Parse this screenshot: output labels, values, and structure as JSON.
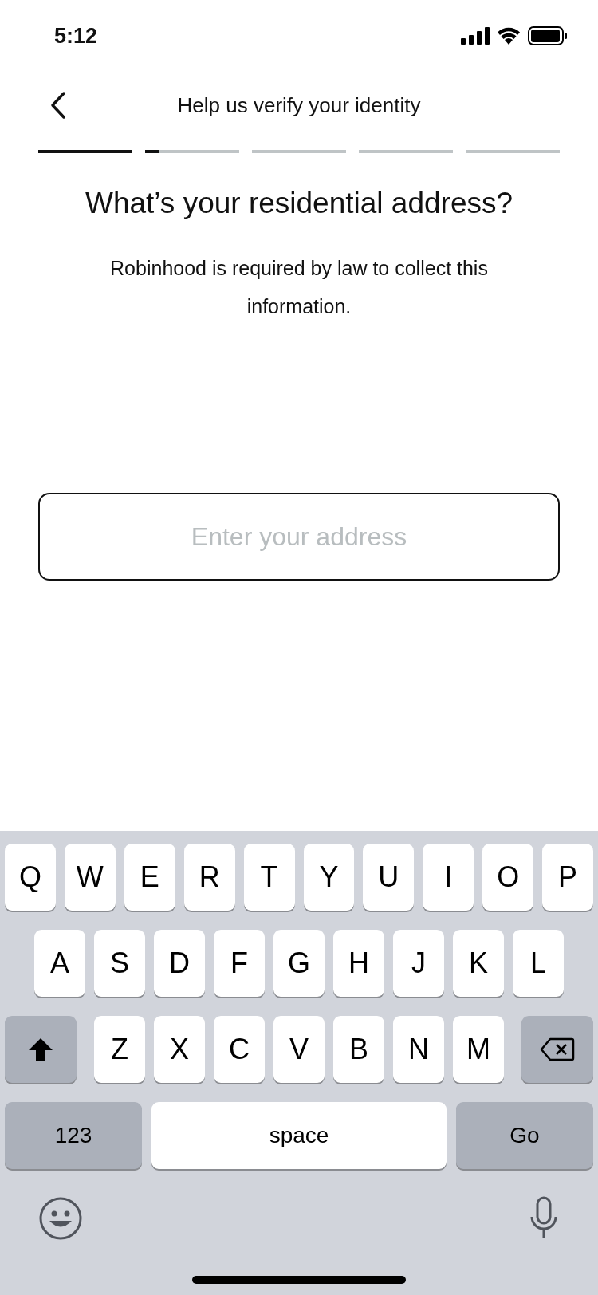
{
  "status_bar": {
    "time": "5:12"
  },
  "header": {
    "title": "Help us verify your identity"
  },
  "progress": [
    {
      "kind": "started",
      "level": 1
    },
    {
      "kind": "started",
      "level": 0.15
    },
    {
      "kind": "upcoming"
    },
    {
      "kind": "upcoming"
    },
    {
      "kind": "upcoming"
    }
  ],
  "heading": "What’s your residential address?",
  "subtitle": "Robinhood is required by law to collect this information.",
  "address_field": {
    "placeholder": "Enter your address"
  },
  "keyboard": {
    "rows": [
      {
        "keys": [
          {
            "kind": "letter",
            "label": "Q"
          },
          {
            "kind": "letter",
            "label": "W"
          },
          {
            "kind": "letter",
            "label": "E"
          },
          {
            "kind": "letter",
            "label": "R"
          },
          {
            "kind": "letter",
            "label": "T"
          },
          {
            "kind": "letter",
            "label": "Y"
          },
          {
            "kind": "letter",
            "label": "U"
          },
          {
            "kind": "letter",
            "label": "I"
          },
          {
            "kind": "letter",
            "label": "O"
          },
          {
            "kind": "letter",
            "label": "P"
          }
        ]
      },
      {
        "keys": [
          {
            "kind": "letter",
            "label": "A"
          },
          {
            "kind": "letter",
            "label": "S"
          },
          {
            "kind": "letter",
            "label": "D"
          },
          {
            "kind": "letter",
            "label": "F"
          },
          {
            "kind": "letter",
            "label": "G"
          },
          {
            "kind": "letter",
            "label": "H"
          },
          {
            "kind": "letter",
            "label": "J"
          },
          {
            "kind": "letter",
            "label": "K"
          },
          {
            "kind": "letter",
            "label": "L"
          }
        ]
      },
      {
        "keys": [
          {
            "kind": "shift"
          },
          {
            "kind": "letter",
            "label": "Z"
          },
          {
            "kind": "letter",
            "label": "X"
          },
          {
            "kind": "letter",
            "label": "C"
          },
          {
            "kind": "letter",
            "label": "V"
          },
          {
            "kind": "letter",
            "label": "B"
          },
          {
            "kind": "letter",
            "label": "N"
          },
          {
            "kind": "letter",
            "label": "M"
          },
          {
            "kind": "delete"
          }
        ]
      },
      {
        "keys": [
          {
            "kind": "mode",
            "label": "123"
          },
          {
            "kind": "space",
            "label": "space"
          },
          {
            "kind": "action",
            "label": "Go"
          }
        ]
      }
    ]
  }
}
